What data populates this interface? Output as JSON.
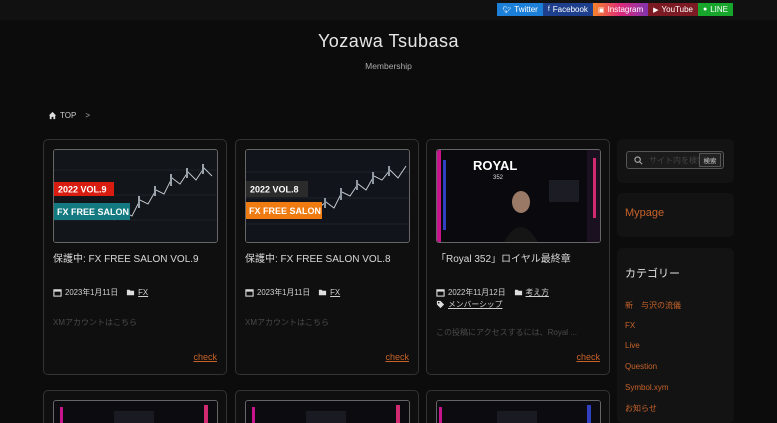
{
  "sns": [
    {
      "label": "Twitter",
      "icon": "twitter-icon"
    },
    {
      "label": "Facebook",
      "icon": "facebook-icon"
    },
    {
      "label": "Instagram",
      "icon": "instagram-icon"
    },
    {
      "label": "YouTube",
      "icon": "youtube-icon"
    },
    {
      "label": "LINE",
      "icon": "line-icon"
    }
  ],
  "site": {
    "title": "Yozawa Tsubasa",
    "subtitle": "Membership"
  },
  "breadcrumb": {
    "home": "TOP",
    "sep": ">"
  },
  "cards": [
    {
      "badge": "2022 VOL.9",
      "salon": "FX FREE SALON",
      "title": "保護中: FX FREE SALON VOL.9",
      "date": "2023年1月11日",
      "category": "FX",
      "excerpt": "XMアカウントはこちら",
      "link": "check"
    },
    {
      "badge": "2022 VOL.8",
      "salon": "FX FREE SALON",
      "title": "保護中: FX FREE SALON VOL.8",
      "date": "2023年1月11日",
      "category": "FX",
      "excerpt": "XMアカウントはこちら",
      "link": "check"
    },
    {
      "thumb_title": "ROYAL",
      "thumb_num": "352",
      "title": "「Royal 352」ロイヤル最終章",
      "date": "2022年11月12日",
      "category": "考え方",
      "tag": "メンバーシップ",
      "excerpt": "この投稿にアクセスするには、Royal ...",
      "link": "check"
    }
  ],
  "sidebar": {
    "search_placeholder": "サイト内を検索",
    "search_button": "検索",
    "mypage": "Mypage",
    "categories_title": "カテゴリー",
    "categories": [
      "新　与沢の流儀",
      "FX",
      "Live",
      "Question",
      "Symbol.xym",
      "お知らせ"
    ]
  },
  "colors": {
    "accent": "#c7632a",
    "background": "#0c0c0c",
    "badge_red": "#d81d10",
    "badge_teal": "#127a80",
    "badge_orange": "#f07b10"
  }
}
